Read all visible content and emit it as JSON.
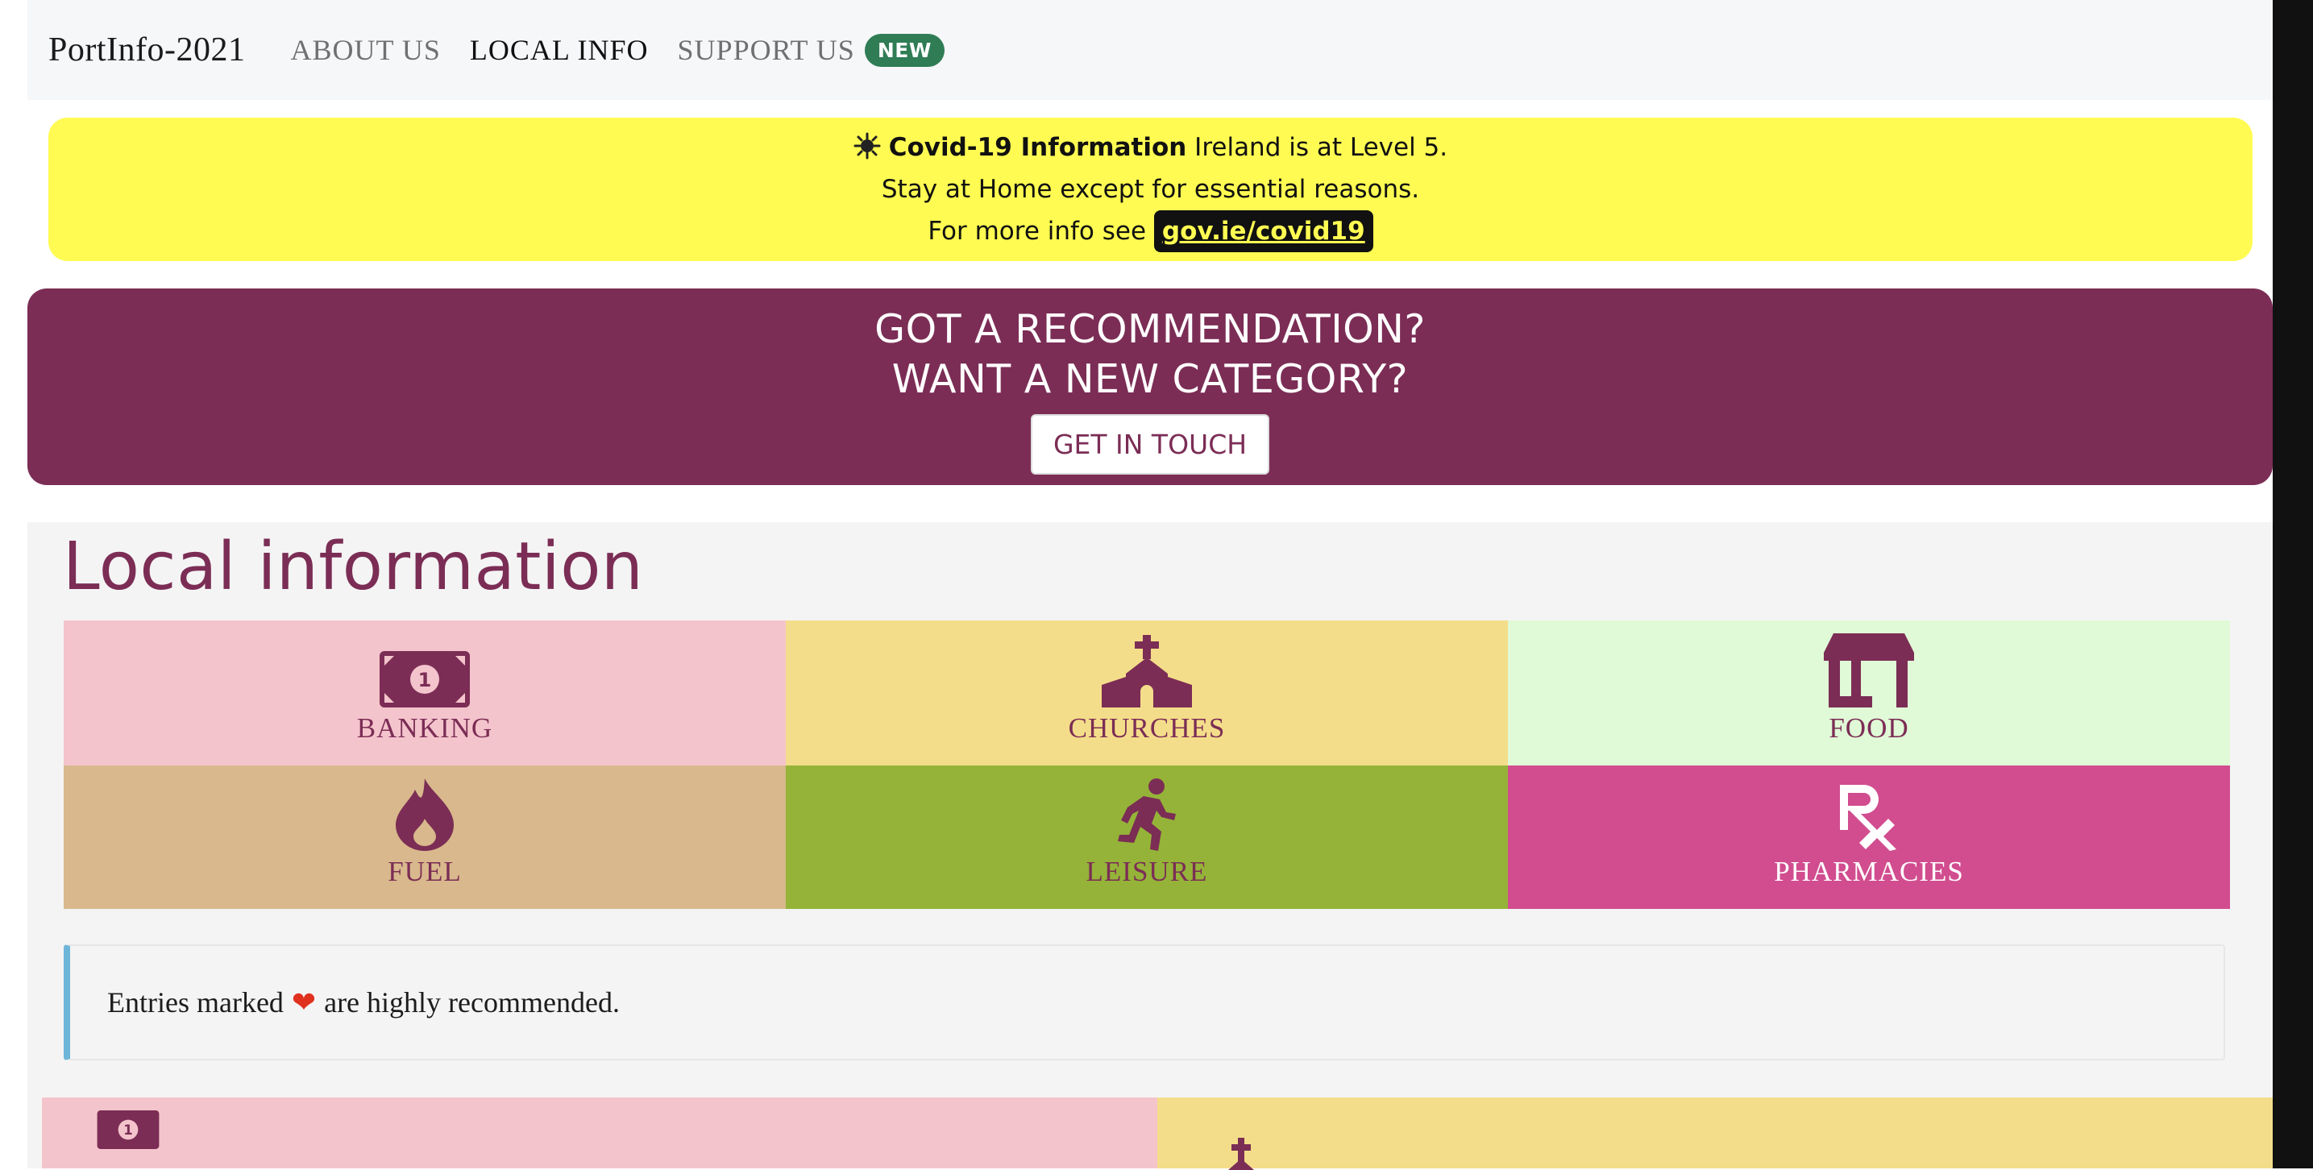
{
  "navbar": {
    "brand": "PortInfo-2021",
    "links": [
      {
        "label": "ABOUT US"
      },
      {
        "label": "LOCAL INFO"
      },
      {
        "label": "SUPPORT US",
        "badge": "NEW"
      }
    ]
  },
  "covid_alert": {
    "icon": "virus-icon",
    "title": "Covid-19 Information",
    "line1_rest": "Ireland is at Level 5.",
    "line2": "Stay at Home except for essential reasons.",
    "line3_prefix": "For more info see",
    "link_text": "gov.ie/covid19",
    "bg_color": "#fffb52"
  },
  "recommendation": {
    "line1": "GOT A RECOMMENDATION?",
    "line2": "WANT A NEW CATEGORY?",
    "button": "GET IN TOUCH",
    "bg_color": "#7b2d55"
  },
  "local_info": {
    "title": "Local information",
    "categories": [
      {
        "label": "BANKING",
        "icon": "money-bill-icon",
        "color": "#f4c4cc"
      },
      {
        "label": "CHURCHES",
        "icon": "church-icon",
        "color": "#f4dd8a"
      },
      {
        "label": "FOOD",
        "icon": "store-icon",
        "color": "#e0f9d6"
      },
      {
        "label": "FUEL",
        "icon": "fire-icon",
        "color": "#d8b88c"
      },
      {
        "label": "LEISURE",
        "icon": "running-icon",
        "color": "#95b338"
      },
      {
        "label": "PHARMACIES",
        "icon": "prescription-icon",
        "color": "#d14d8f"
      }
    ],
    "note": {
      "prefix": "Entries marked",
      "heart": "❤",
      "suffix": "are highly recommended."
    }
  }
}
